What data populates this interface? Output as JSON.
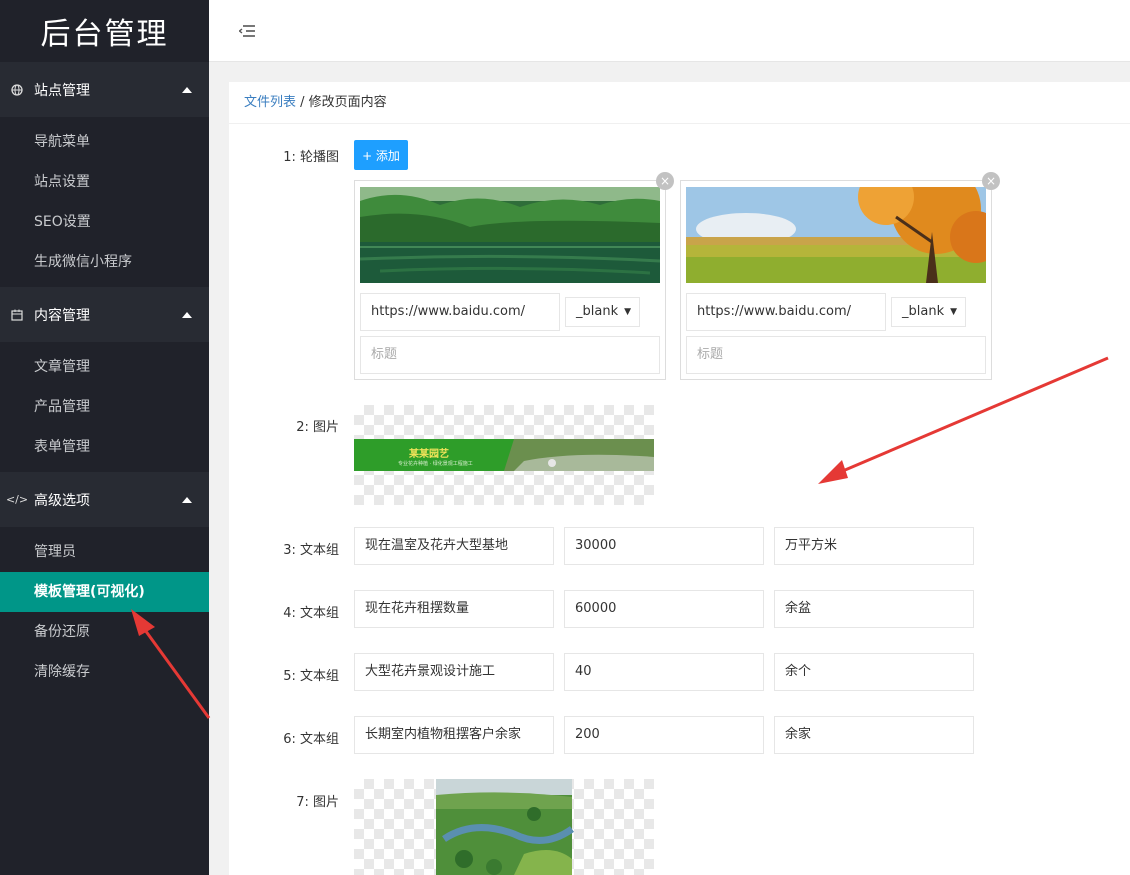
{
  "app": {
    "logo": "后台管理"
  },
  "sidebar": {
    "groups": [
      {
        "label": "站点管理",
        "icon": "globe-icon",
        "items": [
          "导航菜单",
          "站点设置",
          "SEO设置",
          "生成微信小程序"
        ]
      },
      {
        "label": "内容管理",
        "icon": "calendar-icon",
        "items": [
          "文章管理",
          "产品管理",
          "表单管理"
        ]
      },
      {
        "label": "高级选项",
        "icon": "code-icon",
        "items": [
          "管理员",
          "模板管理(可视化)",
          "备份还原",
          "清除缓存"
        ]
      }
    ],
    "active_item": "模板管理(可视化)"
  },
  "breadcrumb": {
    "link": "文件列表",
    "separator": " / ",
    "current": "修改页面内容"
  },
  "form": {
    "add_button": "+ 添加",
    "rows": [
      {
        "label": "1:  轮播图"
      },
      {
        "label": "2:  图片"
      },
      {
        "label": "3:  文本组",
        "values": [
          "现在温室及花卉大型基地",
          "30000",
          "万平方米"
        ]
      },
      {
        "label": "4:  文本组",
        "values": [
          "现在花卉租摆数量",
          "60000",
          "余盆"
        ]
      },
      {
        "label": "5:  文本组",
        "values": [
          "大型花卉景观设计施工",
          "40",
          "余个"
        ]
      },
      {
        "label": "6:  文本组",
        "values": [
          "长期室内植物租摆客户余家",
          "200",
          "余家"
        ]
      },
      {
        "label": "7:  图片"
      }
    ],
    "slides": [
      {
        "url": "https://www.baidu.com/",
        "target": "_blank",
        "title_placeholder": "标题",
        "close": "×"
      },
      {
        "url": "https://www.baidu.com/",
        "target": "_blank",
        "title_placeholder": "标题",
        "close": "×"
      }
    ],
    "banner_text": "某某园艺",
    "banner_subtext": "专业花卉种植 · 绿化景观工程施工",
    "dropdown_arrow": "▼"
  },
  "colors": {
    "sidebar_bg": "#20222a",
    "active": "#009688",
    "primary_button": "#1e9fff",
    "annotation_arrow": "#e53935"
  }
}
